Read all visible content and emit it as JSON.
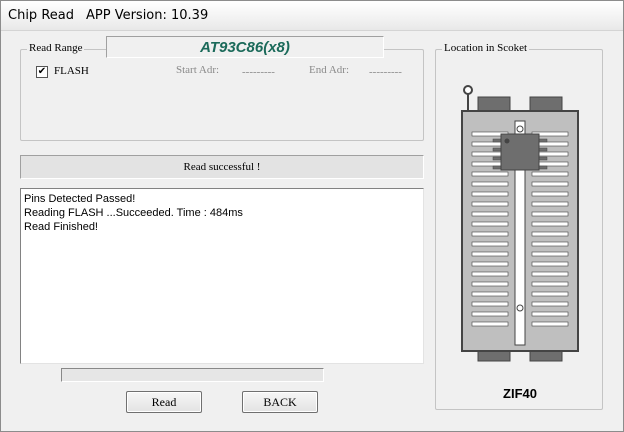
{
  "window": {
    "title": "Chip Read",
    "app_version": "APP Version: 10.39"
  },
  "chip": {
    "name": "AT93C86(x8)"
  },
  "read_range": {
    "group_label": "Read Range",
    "checkbox_checked": true,
    "checkbox_glyph": "✔",
    "flash_label": "FLASH",
    "start_adr_label": "Start Adr:",
    "start_adr_value": "---------",
    "end_adr_label": "End Adr:",
    "end_adr_value": "---------"
  },
  "status": {
    "text": "Read successful !"
  },
  "log": {
    "lines": [
      "Pins Detected Passed!",
      "Reading FLASH ...Succeeded. Time : 484ms",
      "Read Finished!"
    ]
  },
  "progress": {
    "fraction": 0
  },
  "buttons": {
    "read": "Read",
    "back": "BACK"
  },
  "socket": {
    "group_label": "Location in Scoket",
    "socket_name": "ZIF40",
    "pins_per_side": 20,
    "chip_pins_per_side": 4,
    "colors": {
      "body": "#bfbfbf",
      "outline": "#444444",
      "pin_slot": "#ffffff",
      "chip": "#6e6e6e"
    }
  }
}
